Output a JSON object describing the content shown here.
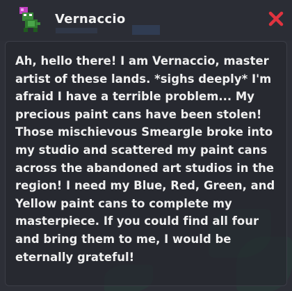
{
  "dialog": {
    "npc_name": "Vernaccio",
    "message": "Ah, hello there! I am Vernaccio, master artist of these lands. *sighs deeply* I'm afraid I have a terrible problem... My precious paint cans have been stolen! Those mischievous Smeargle broke into my studio and scattered my paint cans across the abandoned art studios in the region! I need my Blue, Red, Green, and Yellow paint cans to complete my masterpiece. If you could find all four and bring them to me, I would be eternally grateful!"
  },
  "icons": {
    "portrait": "npc-portrait-icon",
    "close": "close-x-icon"
  },
  "colors": {
    "background": "#2d2f37",
    "text": "#f0f0f0",
    "close": "#e0333f",
    "border": "#3b3d46"
  }
}
